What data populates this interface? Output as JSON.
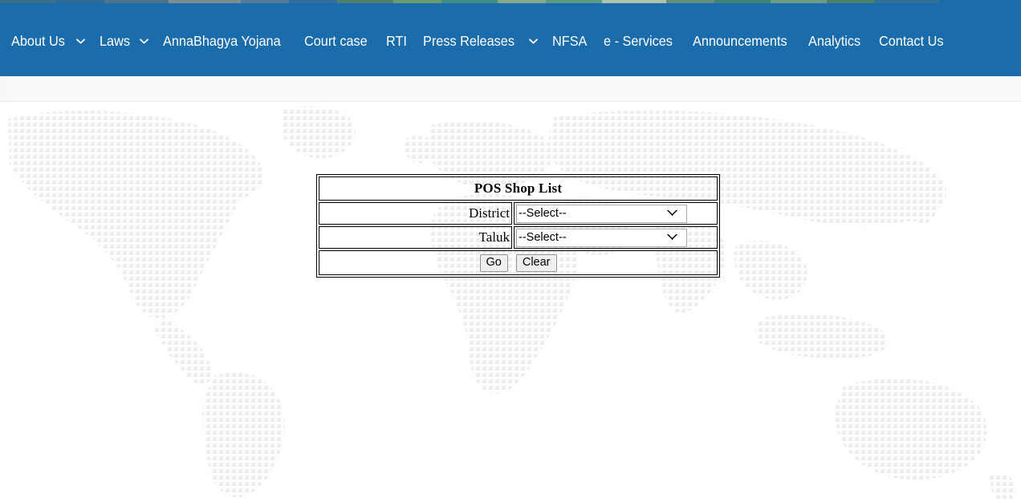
{
  "colors": {
    "navbar_bg": "#1b6cab",
    "nav_text": "#ffffff",
    "subbar_bg": "#f6f8fa",
    "page_bg": "#ffffff",
    "map_dot": "#edf0f2",
    "table_border": "#000000",
    "button_bg": "#efefef"
  },
  "navbar": {
    "items": [
      {
        "label": "About Us",
        "has_caret": true,
        "icon": "chevron-down-icon"
      },
      {
        "label": "Laws",
        "has_caret": true,
        "icon": "chevron-down-icon"
      },
      {
        "label": "AnnaBhagya Yojana",
        "has_caret": false
      },
      {
        "label": "Court case",
        "has_caret": false
      },
      {
        "label": "RTI",
        "has_caret": false
      },
      {
        "label": "Press Releases",
        "has_caret": true,
        "icon": "chevron-down-icon"
      },
      {
        "label": "NFSA",
        "has_caret": false
      },
      {
        "label": "e - Services",
        "has_caret": false
      },
      {
        "label": "Announcements",
        "has_caret": false
      },
      {
        "label": "Analytics",
        "has_caret": false
      },
      {
        "label": "Contact Us",
        "has_caret": false
      }
    ]
  },
  "form": {
    "title": "POS Shop List",
    "district": {
      "label": "District",
      "selected": "--Select--",
      "options": [
        "--Select--"
      ]
    },
    "taluk": {
      "label": "Taluk",
      "selected": "--Select--",
      "options": [
        "--Select--"
      ]
    },
    "buttons": {
      "go": "Go",
      "clear": "Clear"
    }
  }
}
